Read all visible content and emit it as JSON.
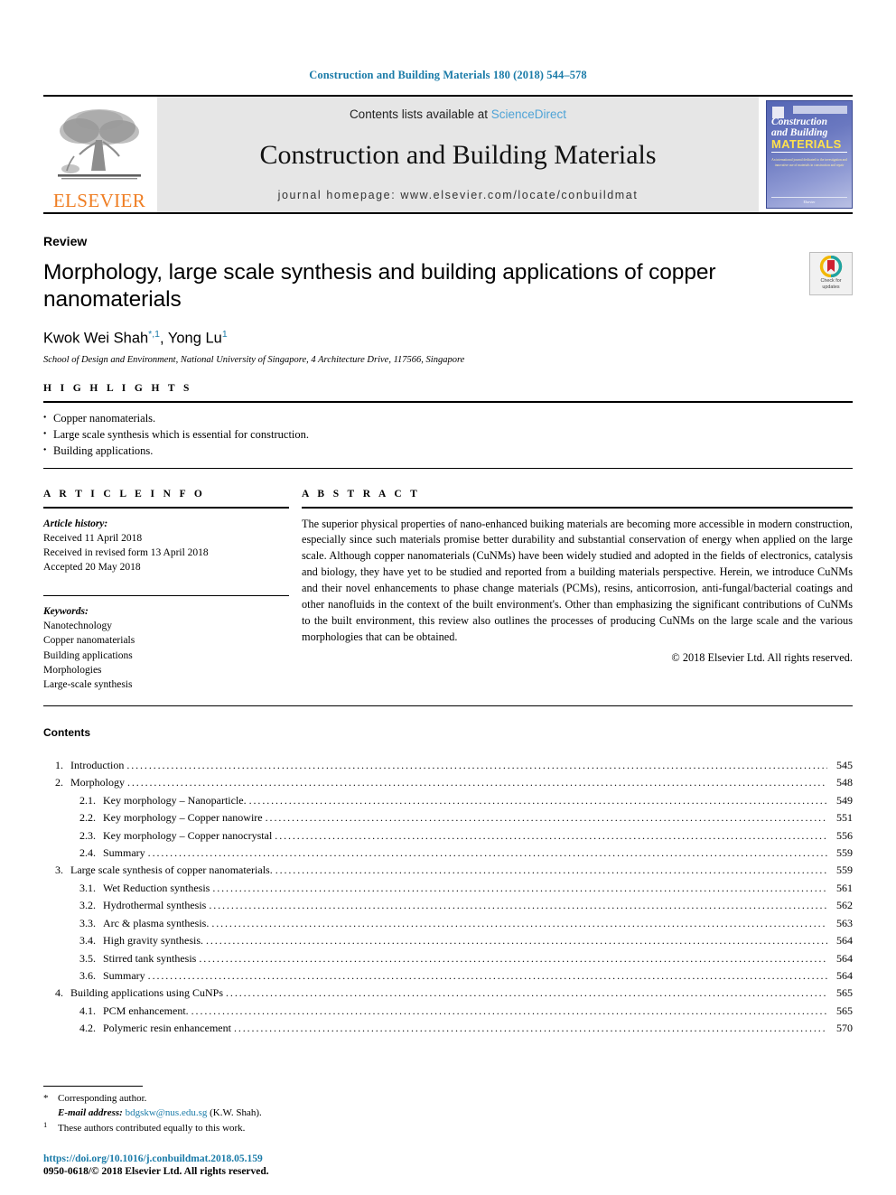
{
  "running_head": "Construction and Building Materials 180 (2018) 544–578",
  "masthead": {
    "publisher_word": "ELSEVIER",
    "contents_prefix": "Contents lists available at ",
    "contents_link": "ScienceDirect",
    "journal_title": "Construction and Building Materials",
    "homepage": "journal homepage: www.elsevier.com/locate/conbuildmat",
    "cover": {
      "line1": "Construction",
      "line2": "and Building",
      "line3": "MATERIALS",
      "blurb": "An international journal dedicated to the investigation and innovative use of materials in construction and repair",
      "footer": "Elsevier"
    }
  },
  "article": {
    "doctype": "Review",
    "title": "Morphology, large scale synthesis and building applications of copper nanomaterials",
    "author1": "Kwok Wei Shah",
    "author1_sup": "*,1",
    "author2": "Yong Lu",
    "author2_sup": "1",
    "affiliation": "School of Design and Environment, National University of Singapore, 4 Architecture Drive, 117566, Singapore",
    "crossmark_line1": "Check for",
    "crossmark_line2": "updates"
  },
  "highlights": {
    "heading": "H I G H L I G H T S",
    "items": [
      "Copper nanomaterials.",
      "Large scale synthesis which is essential for construction.",
      "Building applications."
    ]
  },
  "article_info": {
    "heading": "A R T I C L E   I N F O",
    "history_label": "Article history:",
    "history": [
      "Received 11 April 2018",
      "Received in revised form 13 April 2018",
      "Accepted 20 May 2018"
    ],
    "keywords_label": "Keywords:",
    "keywords": [
      "Nanotechnology",
      "Copper nanomaterials",
      "Building applications",
      "Morphologies",
      "Large-scale synthesis"
    ]
  },
  "abstract": {
    "heading": "A B S T R A C T",
    "body": "The superior physical properties of nano-enhanced buiking materials are becoming more accessible in modern construction, especially since such materials promise better durability and substantial conservation of energy when applied on the large scale. Although copper nanomaterials (CuNMs) have been widely studied and adopted in the fields of electronics, catalysis and biology, they have yet to be studied and reported from a building materials perspective. Herein, we introduce CuNMs and their novel enhancements to phase change materials (PCMs), resins, anticorrosion, anti-fungal/bacterial coatings and other nanofluids in the context of the built environment's. Other than emphasizing the significant contributions of CuNMs to the built environment, this review also outlines the processes of producing CuNMs on the large scale and the various morphologies that can be obtained.",
    "copyright": "© 2018 Elsevier Ltd. All rights reserved."
  },
  "contents": {
    "heading": "Contents",
    "entries": [
      {
        "num": "1.",
        "label": "Introduction",
        "page": "545",
        "sub": false
      },
      {
        "num": "2.",
        "label": "Morphology",
        "page": "548",
        "sub": false
      },
      {
        "num": "2.1.",
        "label": "Key morphology – Nanoparticle.",
        "page": "549",
        "sub": true
      },
      {
        "num": "2.2.",
        "label": "Key morphology – Copper nanowire",
        "page": "551",
        "sub": true
      },
      {
        "num": "2.3.",
        "label": "Key morphology – Copper nanocrystal",
        "page": "556",
        "sub": true
      },
      {
        "num": "2.4.",
        "label": "Summary",
        "page": "559",
        "sub": true
      },
      {
        "num": "3.",
        "label": "Large scale synthesis of copper nanomaterials.",
        "page": "559",
        "sub": false
      },
      {
        "num": "3.1.",
        "label": "Wet Reduction synthesis",
        "page": "561",
        "sub": true
      },
      {
        "num": "3.2.",
        "label": "Hydrothermal synthesis",
        "page": "562",
        "sub": true
      },
      {
        "num": "3.3.",
        "label": "Arc & plasma synthesis.",
        "page": "563",
        "sub": true
      },
      {
        "num": "3.4.",
        "label": "High gravity synthesis.",
        "page": "564",
        "sub": true
      },
      {
        "num": "3.5.",
        "label": "Stirred tank synthesis",
        "page": "564",
        "sub": true
      },
      {
        "num": "3.6.",
        "label": "Summary",
        "page": "564",
        "sub": true
      },
      {
        "num": "4.",
        "label": "Building applications using CuNPs",
        "page": "565",
        "sub": false
      },
      {
        "num": "4.1.",
        "label": "PCM enhancement.",
        "page": "565",
        "sub": true
      },
      {
        "num": "4.2.",
        "label": "Polymeric resin enhancement",
        "page": "570",
        "sub": true
      }
    ]
  },
  "footnotes": {
    "corresponding_mark": "*",
    "corresponding": "Corresponding author.",
    "email_label": "E-mail address:",
    "email": "bdgskw@nus.edu.sg",
    "email_owner": "(K.W. Shah).",
    "equal_mark": "1",
    "equal_contrib": "These authors contributed equally to this work.",
    "doi": "https://doi.org/10.1016/j.conbuildmat.2018.05.159",
    "issn": "0950-0618/© 2018 Elsevier Ltd. All rights reserved."
  },
  "colors": {
    "link": "#1a7ba8",
    "sciencedirect": "#4ea3d6",
    "elsevier_orange": "#ef7d22",
    "band_gray": "#e6e6e6"
  }
}
